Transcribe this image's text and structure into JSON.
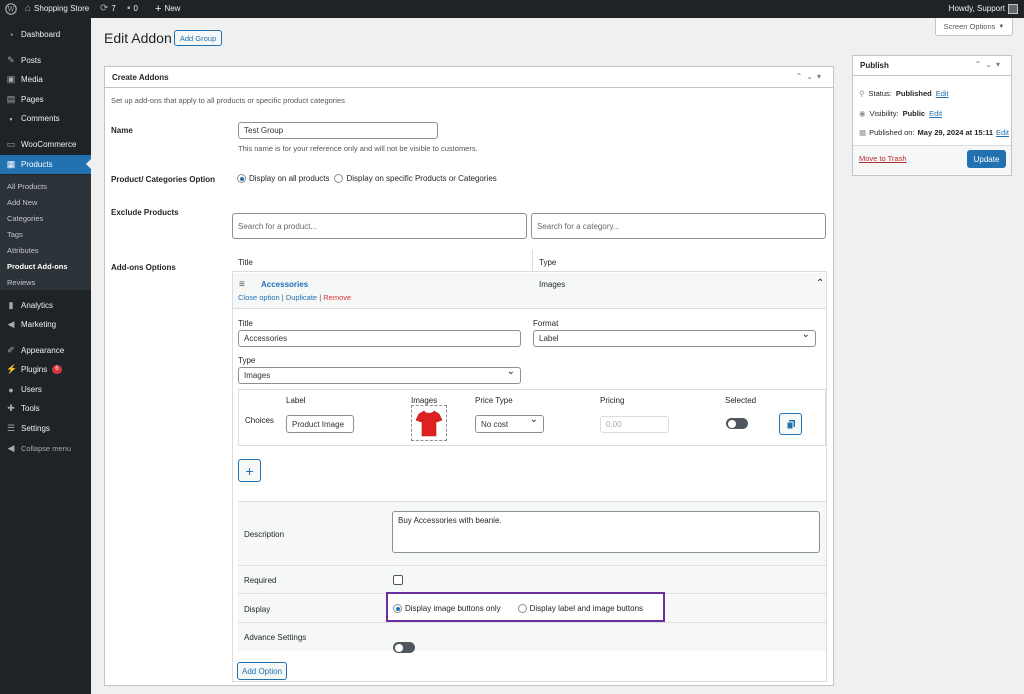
{
  "adminbar": {
    "site_name": "Shopping Store",
    "updates_count": "7",
    "comments_count": "0",
    "new_label": "New",
    "howdy": "Howdy, Support"
  },
  "sidebar": {
    "items": [
      {
        "label": "Dashboard",
        "icon": "dashboard-icon"
      },
      {
        "label": "Posts",
        "icon": "pin-icon"
      },
      {
        "label": "Media",
        "icon": "media-icon"
      },
      {
        "label": "Pages",
        "icon": "pages-icon"
      },
      {
        "label": "Comments",
        "icon": "comment-icon"
      },
      {
        "label": "WooCommerce",
        "icon": "woocommerce-icon"
      },
      {
        "label": "Products",
        "icon": "products-icon"
      },
      {
        "label": "Analytics",
        "icon": "analytics-icon"
      },
      {
        "label": "Marketing",
        "icon": "megaphone-icon"
      },
      {
        "label": "Appearance",
        "icon": "brush-icon"
      },
      {
        "label": "Plugins",
        "icon": "plugin-icon",
        "badge": "6"
      },
      {
        "label": "Users",
        "icon": "users-icon"
      },
      {
        "label": "Tools",
        "icon": "wrench-icon"
      },
      {
        "label": "Settings",
        "icon": "settings-icon"
      },
      {
        "label": "Collapse menu",
        "icon": "collapse-icon"
      }
    ],
    "submenu": [
      "All Products",
      "Add New",
      "Categories",
      "Tags",
      "Attributes",
      "Product Add-ons",
      "Reviews"
    ]
  },
  "header": {
    "title": "Edit Addon",
    "add_group": "Add Group",
    "screen_options": "Screen Options"
  },
  "addon_box": {
    "title": "Create Addons",
    "intro": "Set up add-ons that apply to all products or specific product categories",
    "name_label": "Name",
    "name_value": "Test Group",
    "name_help": "This name is for your reference only and will not be visible to customers.",
    "categories_label": "Product/ Categories Option",
    "radio_all": "Display on all products",
    "radio_specific": "Display on specific Products or Categories",
    "exclude_label": "Exclude Products",
    "search_product_ph": "Search for a product...",
    "search_category_ph": "Search for a category...",
    "addons_label": "Add-ons Options",
    "col_title": "Title",
    "col_type": "Type",
    "option_name": "Accessories",
    "option_type": "Images",
    "close_option": "Close option",
    "duplicate": "Duplicate",
    "remove": "Remove",
    "title_label": "Title",
    "title_value": "Accessories",
    "format_label": "Format",
    "format_value": "Label",
    "type_label": "Type",
    "type_value": "Images",
    "choices": {
      "row_label": "Choices",
      "h_label": "Label",
      "h_images": "Images",
      "h_price_type": "Price Type",
      "h_pricing": "Pricing",
      "h_selected": "Selected",
      "label_value": "Product Image",
      "price_type_value": "No cost",
      "pricing_placeholder": "0.00"
    },
    "description_label": "Description",
    "description_value": "Buy Accessories with beanie.",
    "required_label": "Required",
    "display_label": "Display",
    "display_opt1": "Display image buttons only",
    "display_opt2": "Display label and image buttons",
    "advance_label": "Advance Settings",
    "add_option": "Add Option",
    "highlight_color": "#6b2fa0",
    "accent_color": "#2271b1",
    "tshirt_color": "#e02020"
  },
  "publish": {
    "title": "Publish",
    "status_label": "Status:",
    "status_value": "Published",
    "visibility_label": "Visibility:",
    "visibility_value": "Public",
    "published_label": "Published on:",
    "published_value": "May 29, 2024 at 15:11",
    "edit": "Edit",
    "trash": "Move to Trash",
    "update": "Update"
  }
}
